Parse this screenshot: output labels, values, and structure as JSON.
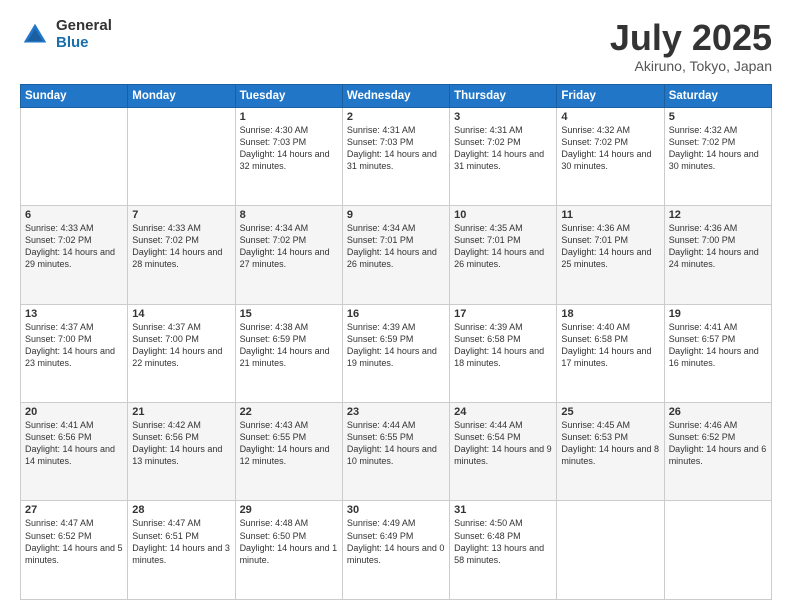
{
  "logo": {
    "general": "General",
    "blue": "Blue"
  },
  "title": "July 2025",
  "location": "Akiruno, Tokyo, Japan",
  "days_of_week": [
    "Sunday",
    "Monday",
    "Tuesday",
    "Wednesday",
    "Thursday",
    "Friday",
    "Saturday"
  ],
  "weeks": [
    [
      {
        "day": "",
        "sunrise": "",
        "sunset": "",
        "daylight": ""
      },
      {
        "day": "",
        "sunrise": "",
        "sunset": "",
        "daylight": ""
      },
      {
        "day": "1",
        "sunrise": "Sunrise: 4:30 AM",
        "sunset": "Sunset: 7:03 PM",
        "daylight": "Daylight: 14 hours and 32 minutes."
      },
      {
        "day": "2",
        "sunrise": "Sunrise: 4:31 AM",
        "sunset": "Sunset: 7:03 PM",
        "daylight": "Daylight: 14 hours and 31 minutes."
      },
      {
        "day": "3",
        "sunrise": "Sunrise: 4:31 AM",
        "sunset": "Sunset: 7:02 PM",
        "daylight": "Daylight: 14 hours and 31 minutes."
      },
      {
        "day": "4",
        "sunrise": "Sunrise: 4:32 AM",
        "sunset": "Sunset: 7:02 PM",
        "daylight": "Daylight: 14 hours and 30 minutes."
      },
      {
        "day": "5",
        "sunrise": "Sunrise: 4:32 AM",
        "sunset": "Sunset: 7:02 PM",
        "daylight": "Daylight: 14 hours and 30 minutes."
      }
    ],
    [
      {
        "day": "6",
        "sunrise": "Sunrise: 4:33 AM",
        "sunset": "Sunset: 7:02 PM",
        "daylight": "Daylight: 14 hours and 29 minutes."
      },
      {
        "day": "7",
        "sunrise": "Sunrise: 4:33 AM",
        "sunset": "Sunset: 7:02 PM",
        "daylight": "Daylight: 14 hours and 28 minutes."
      },
      {
        "day": "8",
        "sunrise": "Sunrise: 4:34 AM",
        "sunset": "Sunset: 7:02 PM",
        "daylight": "Daylight: 14 hours and 27 minutes."
      },
      {
        "day": "9",
        "sunrise": "Sunrise: 4:34 AM",
        "sunset": "Sunset: 7:01 PM",
        "daylight": "Daylight: 14 hours and 26 minutes."
      },
      {
        "day": "10",
        "sunrise": "Sunrise: 4:35 AM",
        "sunset": "Sunset: 7:01 PM",
        "daylight": "Daylight: 14 hours and 26 minutes."
      },
      {
        "day": "11",
        "sunrise": "Sunrise: 4:36 AM",
        "sunset": "Sunset: 7:01 PM",
        "daylight": "Daylight: 14 hours and 25 minutes."
      },
      {
        "day": "12",
        "sunrise": "Sunrise: 4:36 AM",
        "sunset": "Sunset: 7:00 PM",
        "daylight": "Daylight: 14 hours and 24 minutes."
      }
    ],
    [
      {
        "day": "13",
        "sunrise": "Sunrise: 4:37 AM",
        "sunset": "Sunset: 7:00 PM",
        "daylight": "Daylight: 14 hours and 23 minutes."
      },
      {
        "day": "14",
        "sunrise": "Sunrise: 4:37 AM",
        "sunset": "Sunset: 7:00 PM",
        "daylight": "Daylight: 14 hours and 22 minutes."
      },
      {
        "day": "15",
        "sunrise": "Sunrise: 4:38 AM",
        "sunset": "Sunset: 6:59 PM",
        "daylight": "Daylight: 14 hours and 21 minutes."
      },
      {
        "day": "16",
        "sunrise": "Sunrise: 4:39 AM",
        "sunset": "Sunset: 6:59 PM",
        "daylight": "Daylight: 14 hours and 19 minutes."
      },
      {
        "day": "17",
        "sunrise": "Sunrise: 4:39 AM",
        "sunset": "Sunset: 6:58 PM",
        "daylight": "Daylight: 14 hours and 18 minutes."
      },
      {
        "day": "18",
        "sunrise": "Sunrise: 4:40 AM",
        "sunset": "Sunset: 6:58 PM",
        "daylight": "Daylight: 14 hours and 17 minutes."
      },
      {
        "day": "19",
        "sunrise": "Sunrise: 4:41 AM",
        "sunset": "Sunset: 6:57 PM",
        "daylight": "Daylight: 14 hours and 16 minutes."
      }
    ],
    [
      {
        "day": "20",
        "sunrise": "Sunrise: 4:41 AM",
        "sunset": "Sunset: 6:56 PM",
        "daylight": "Daylight: 14 hours and 14 minutes."
      },
      {
        "day": "21",
        "sunrise": "Sunrise: 4:42 AM",
        "sunset": "Sunset: 6:56 PM",
        "daylight": "Daylight: 14 hours and 13 minutes."
      },
      {
        "day": "22",
        "sunrise": "Sunrise: 4:43 AM",
        "sunset": "Sunset: 6:55 PM",
        "daylight": "Daylight: 14 hours and 12 minutes."
      },
      {
        "day": "23",
        "sunrise": "Sunrise: 4:44 AM",
        "sunset": "Sunset: 6:55 PM",
        "daylight": "Daylight: 14 hours and 10 minutes."
      },
      {
        "day": "24",
        "sunrise": "Sunrise: 4:44 AM",
        "sunset": "Sunset: 6:54 PM",
        "daylight": "Daylight: 14 hours and 9 minutes."
      },
      {
        "day": "25",
        "sunrise": "Sunrise: 4:45 AM",
        "sunset": "Sunset: 6:53 PM",
        "daylight": "Daylight: 14 hours and 8 minutes."
      },
      {
        "day": "26",
        "sunrise": "Sunrise: 4:46 AM",
        "sunset": "Sunset: 6:52 PM",
        "daylight": "Daylight: 14 hours and 6 minutes."
      }
    ],
    [
      {
        "day": "27",
        "sunrise": "Sunrise: 4:47 AM",
        "sunset": "Sunset: 6:52 PM",
        "daylight": "Daylight: 14 hours and 5 minutes."
      },
      {
        "day": "28",
        "sunrise": "Sunrise: 4:47 AM",
        "sunset": "Sunset: 6:51 PM",
        "daylight": "Daylight: 14 hours and 3 minutes."
      },
      {
        "day": "29",
        "sunrise": "Sunrise: 4:48 AM",
        "sunset": "Sunset: 6:50 PM",
        "daylight": "Daylight: 14 hours and 1 minute."
      },
      {
        "day": "30",
        "sunrise": "Sunrise: 4:49 AM",
        "sunset": "Sunset: 6:49 PM",
        "daylight": "Daylight: 14 hours and 0 minutes."
      },
      {
        "day": "31",
        "sunrise": "Sunrise: 4:50 AM",
        "sunset": "Sunset: 6:48 PM",
        "daylight": "Daylight: 13 hours and 58 minutes."
      },
      {
        "day": "",
        "sunrise": "",
        "sunset": "",
        "daylight": ""
      },
      {
        "day": "",
        "sunrise": "",
        "sunset": "",
        "daylight": ""
      }
    ]
  ]
}
